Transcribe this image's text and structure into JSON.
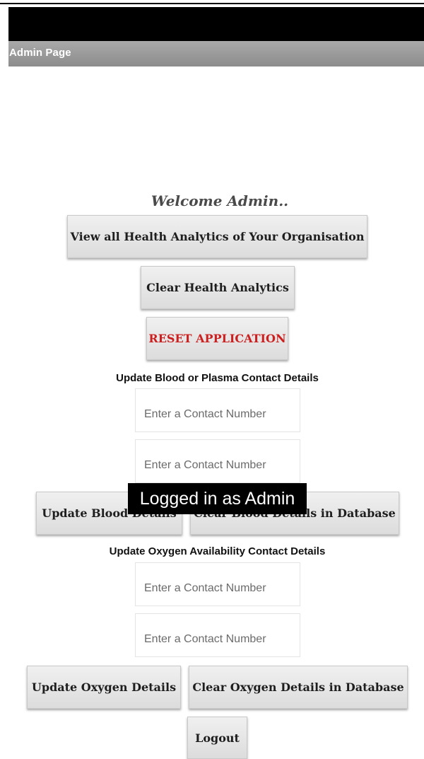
{
  "app": {
    "title": "Admin Page"
  },
  "welcome": "Welcome Admin..",
  "buttons": {
    "view_analytics": "View all Health Analytics of Your Organisation",
    "clear_analytics": "Clear Health Analytics",
    "reset_app": "RESET APPLICATION",
    "update_blood": "Update Blood Details",
    "clear_blood": "Clear Blood Details in Database",
    "update_oxygen": "Update Oxygen Details",
    "clear_oxygen": "Clear Oxygen Details in Database",
    "logout": "Logout"
  },
  "blood_section": {
    "label": "Update Blood or Plasma Contact Details",
    "input1_placeholder": "Enter a Contact Number",
    "input2_placeholder": "Enter a Contact Number"
  },
  "oxygen_section": {
    "label": "Update Oxygen Availability Contact Details",
    "input1_placeholder": "Enter a Contact Number",
    "input2_placeholder": "Enter a Contact Number"
  },
  "toast": "Logged in as Admin",
  "colors": {
    "title_bar": "#999999",
    "reset_text": "#cc1f1f",
    "status_bar": "#000000"
  }
}
